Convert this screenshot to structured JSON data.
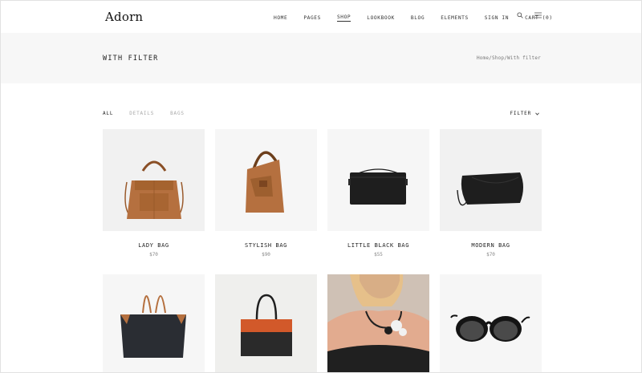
{
  "brand": {
    "logo": "Adorn"
  },
  "nav": {
    "items": [
      {
        "label": "HOME",
        "active": false
      },
      {
        "label": "PAGES",
        "active": false
      },
      {
        "label": "SHOP",
        "active": true
      },
      {
        "label": "LOOKBOOK",
        "active": false
      },
      {
        "label": "BLOG",
        "active": false
      },
      {
        "label": "ELEMENTS",
        "active": false
      },
      {
        "label": "SIGN IN",
        "active": false
      },
      {
        "label": "CART (0)",
        "active": false
      }
    ],
    "icons": [
      "search-icon",
      "hamburger-menu-icon"
    ]
  },
  "title_bar": {
    "title": "WITH FILTER",
    "breadcrumb": "Home/Shop/With filter"
  },
  "filters": {
    "tabs": [
      {
        "label": "ALL",
        "active": true
      },
      {
        "label": "DETAILS",
        "active": false
      },
      {
        "label": "BAGS",
        "active": false
      }
    ],
    "dropdown_label": "FILTER"
  },
  "products": [
    {
      "name": "LADY BAG",
      "price": "$70",
      "image": "tan-leather-tote-image"
    },
    {
      "name": "STYLISH BAG",
      "price": "$90",
      "image": "tan-hobo-bag-image"
    },
    {
      "name": "LITTLE BLACK BAG",
      "price": "$55",
      "image": "black-crossbody-bag-image"
    },
    {
      "name": "MODERN BAG",
      "price": "$70",
      "image": "black-shoulder-bag-image"
    },
    {
      "name": "",
      "price": "",
      "image": "black-tote-tan-handles-image"
    },
    {
      "name": "",
      "price": "",
      "image": "black-orange-handbag-image"
    },
    {
      "name": "",
      "price": "",
      "image": "statement-necklace-model-image"
    },
    {
      "name": "",
      "price": "",
      "image": "black-sunglasses-image"
    }
  ],
  "colors": {
    "tan": "#b5703f",
    "black": "#1e1e1e",
    "orange": "#d2592a",
    "title_bar_bg": "#f7f7f7",
    "image_bg": "#f1f1f1"
  }
}
